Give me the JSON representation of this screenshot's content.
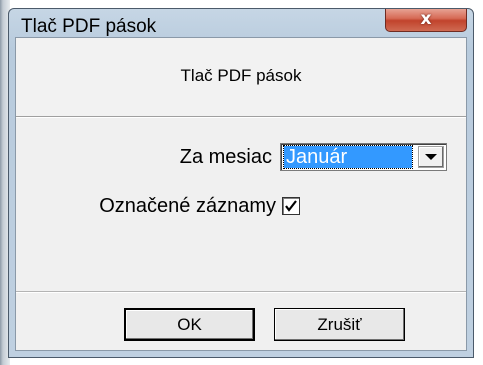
{
  "window": {
    "title": "Tlač PDF pások",
    "close_glyph": "x"
  },
  "header": {
    "text": "Tlač PDF pások"
  },
  "form": {
    "month_label": "Za mesiac",
    "month_value": "Január",
    "marked_label": "Označené záznamy",
    "marked_checked": true
  },
  "buttons": {
    "ok_mnemonic": "O",
    "ok_rest": "K",
    "cancel_mnemonic": "Z",
    "cancel_rest": "rušiť"
  },
  "colors": {
    "selection": "#3399ff",
    "close_button": "#c1432c",
    "frame": "#b8cbdd"
  },
  "icons": {
    "close": "close-icon",
    "dropdown": "chevron-down-icon",
    "checkbox": "check-icon"
  }
}
